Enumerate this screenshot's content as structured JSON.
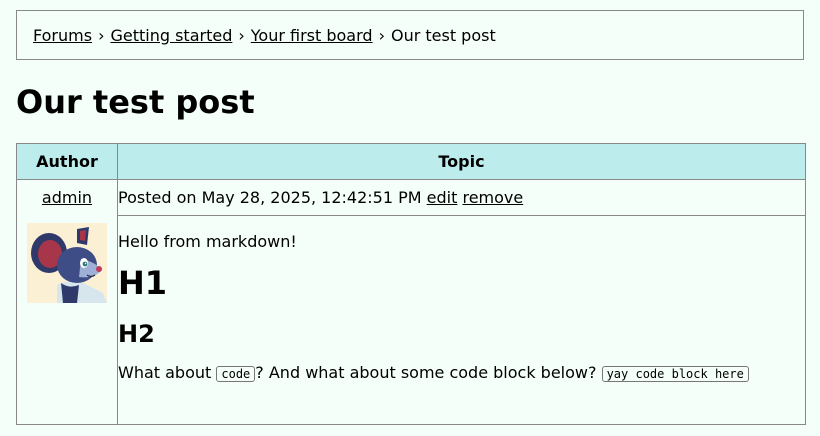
{
  "breadcrumb": {
    "items": [
      "Forums",
      "Getting started",
      "Your first board"
    ],
    "separator": "›",
    "current": "Our test post"
  },
  "page": {
    "title": "Our test post"
  },
  "table": {
    "headers": {
      "author": "Author",
      "topic": "Topic"
    }
  },
  "post": {
    "author": "admin",
    "avatar_icon": "mouse-avatar",
    "meta": {
      "posted_on": "Posted on May 28, 2025, 12:42:51 PM",
      "edit_label": "edit",
      "remove_label": "remove"
    },
    "body": {
      "paragraph": "Hello from markdown!",
      "h1": "H1",
      "h2": "H2",
      "line_part1": "What about ",
      "inline_code": "code",
      "line_part2": "? And what about some code block below? ",
      "code_block": "yay code block here"
    }
  },
  "colors": {
    "background": "#f5fff9",
    "header_bg": "#bdeced",
    "border": "#888888"
  }
}
